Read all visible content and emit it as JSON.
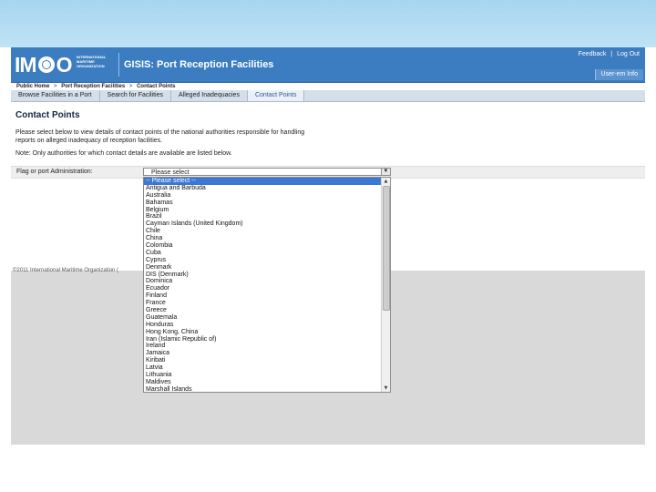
{
  "header": {
    "logo_text_left": "IM",
    "logo_text_right": "O",
    "org_lines": [
      "INTERNATIONAL",
      "MARITIME",
      "ORGANIZATION"
    ],
    "app_title": "GISIS: Port Reception Facilities",
    "feedback_link": "Feedback",
    "link_separator": "|",
    "logout_link": "Log Out",
    "user_button": "User-em Info"
  },
  "breadcrumb": {
    "items": [
      "Public Home",
      "Port Reception Facilities",
      "Contact Points"
    ],
    "separator": ">"
  },
  "tabs": [
    {
      "label": "Browse Facilities in a Port",
      "active": false
    },
    {
      "label": "Search for Facilities",
      "active": false
    },
    {
      "label": "Alleged Inadequacies",
      "active": false
    },
    {
      "label": "Contact Points",
      "active": true
    }
  ],
  "content": {
    "title": "Contact Points",
    "description": "Please select below to view details of contact points of the national authorities responsible for handling reports on alleged inadequacy of reception facilities.",
    "note": "Note: Only authorities for which contact details are available are listed below.",
    "field_label": "Flag or port Administration:",
    "select_value": "Please select"
  },
  "dropdown": {
    "highlighted_index": 0,
    "options": [
      "-- Please select --",
      "Antigua and Barbuda",
      "Australia",
      "Bahamas",
      "Belgium",
      "Brazil",
      "Cayman Islands (United Kingdom)",
      "Chile",
      "China",
      "Colombia",
      "Cuba",
      "Cyprus",
      "Denmark",
      "DIS (Denmark)",
      "Dominica",
      "Ecuador",
      "Finland",
      "France",
      "Greece",
      "Guatemala",
      "Honduras",
      "Hong Kong, China",
      "Iran (Islamic Republic of)",
      "Ireland",
      "Jamaica",
      "Kiribati",
      "Latvia",
      "Lithuania",
      "Maldives",
      "Marshall Islands"
    ]
  },
  "footer": {
    "copyright": "©2011 International Maritime Organization ("
  },
  "colors": {
    "header_blue": "#3c7cc0",
    "tab_bar": "#d4dfe9",
    "highlight": "#3a78d4",
    "slide_top": "#a7d5ef"
  }
}
